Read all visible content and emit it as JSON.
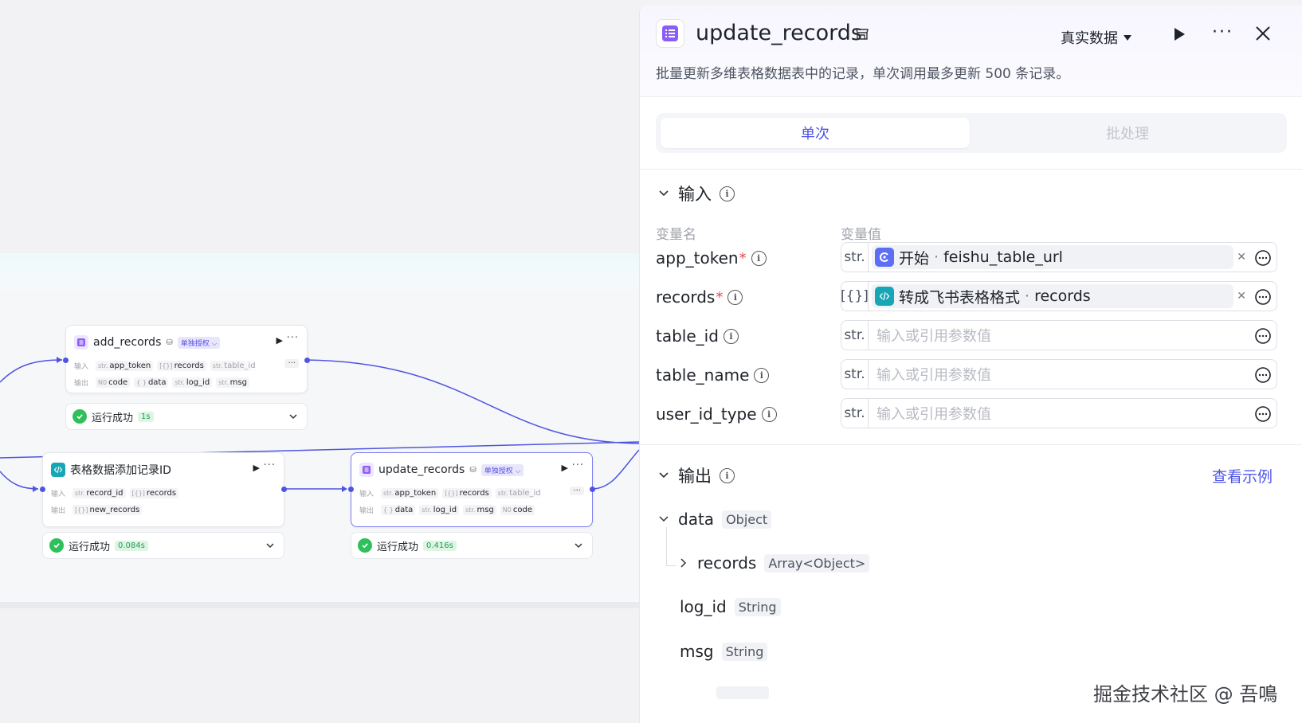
{
  "canvas": {
    "nodes": {
      "add_records": {
        "title": "add_records",
        "auth": "单独授权 ⌵",
        "input_label": "输入",
        "output_label": "输出",
        "inputs": [
          {
            "type": "str.",
            "name": "app_token"
          },
          {
            "type": "[{}]",
            "name": "records"
          },
          {
            "type": "str.",
            "name": "table_id"
          }
        ],
        "outputs": [
          {
            "type": "N0",
            "name": "code"
          },
          {
            "type": "{ }",
            "name": "data"
          },
          {
            "type": "str.",
            "name": "log_id"
          },
          {
            "type": "str.",
            "name": "msg"
          }
        ],
        "more_label": "···",
        "status_text": "运行成功",
        "status_time": "1s"
      },
      "table_add_id": {
        "title": "表格数据添加记录ID",
        "input_label": "输入",
        "output_label": "输出",
        "inputs": [
          {
            "type": "str.",
            "name": "record_id"
          },
          {
            "type": "[{}]",
            "name": "records"
          }
        ],
        "outputs": [
          {
            "type": "[{}]",
            "name": "new_records"
          }
        ],
        "status_text": "运行成功",
        "status_time": "0.084s"
      },
      "update_records": {
        "title": "update_records",
        "auth": "单独授权 ⌵",
        "input_label": "输入",
        "output_label": "输出",
        "inputs": [
          {
            "type": "str.",
            "name": "app_token"
          },
          {
            "type": "[{}]",
            "name": "records"
          },
          {
            "type": "str.",
            "name": "table_id"
          }
        ],
        "outputs": [
          {
            "type": "{ }",
            "name": "data"
          },
          {
            "type": "str.",
            "name": "log_id"
          },
          {
            "type": "str.",
            "name": "msg"
          },
          {
            "type": "N0",
            "name": "code"
          }
        ],
        "more_label": "···",
        "status_text": "运行成功",
        "status_time": "0.416s"
      }
    }
  },
  "panel": {
    "title": "update_records",
    "mode": "真实数据",
    "description": "批量更新多维表格数据表中的记录，单次调用最多更新 500 条记录。",
    "tabs": [
      "单次",
      "批处理"
    ],
    "input_section": {
      "title": "输入",
      "col_name": "变量名",
      "col_value": "变量值",
      "params": [
        {
          "name": "app_token",
          "required": true,
          "type": "str.",
          "ref_source": "开始",
          "ref_field": "feishu_table_url",
          "icon": "start-icon"
        },
        {
          "name": "records",
          "required": true,
          "type": "[{}]",
          "ref_source": "转成飞书表格格式",
          "ref_field": "records",
          "icon": "code-icon"
        },
        {
          "name": "table_id",
          "required": false,
          "type": "str.",
          "placeholder": "输入或引用参数值"
        },
        {
          "name": "table_name",
          "required": false,
          "type": "str.",
          "placeholder": "输入或引用参数值"
        },
        {
          "name": "user_id_type",
          "required": false,
          "type": "str.",
          "placeholder": "输入或引用参数值"
        }
      ]
    },
    "output_section": {
      "title": "输出",
      "example_link": "查看示例",
      "fields": [
        {
          "name": "data",
          "type": "Object"
        },
        {
          "name": "records",
          "type": "Array<Object>"
        },
        {
          "name": "log_id",
          "type": "String"
        },
        {
          "name": "msg",
          "type": "String"
        }
      ]
    }
  },
  "watermark": "掘金技术社区 @ 吾鳴",
  "colors": {
    "accent": "#4e55e8",
    "edge": "#4f55e0",
    "success": "#2fbf5b",
    "code_teal": "#16a6b6"
  }
}
